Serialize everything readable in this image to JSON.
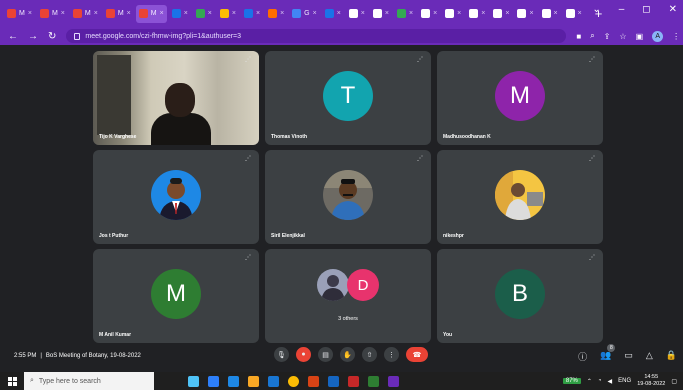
{
  "browser": {
    "tabs": [
      {
        "label": "M",
        "color": "#ea4335"
      },
      {
        "label": "M",
        "color": "#ea4335"
      },
      {
        "label": "M",
        "color": "#ea4335"
      },
      {
        "label": "M",
        "color": "#ea4335"
      },
      {
        "label": "M",
        "color": "#ea4335",
        "active": true
      },
      {
        "label": "",
        "color": "#1a73e8"
      },
      {
        "label": "",
        "color": "#34a853"
      },
      {
        "label": "",
        "color": "#fbbc04"
      },
      {
        "label": "",
        "color": "#1a73e8"
      },
      {
        "label": "",
        "color": "#ff6d00"
      },
      {
        "label": "G",
        "color": "#4285f4"
      },
      {
        "label": "",
        "color": "#1a73e8"
      },
      {
        "label": "",
        "color": "#ffffff"
      },
      {
        "label": "",
        "color": "#ffffff"
      },
      {
        "label": "",
        "color": "#34a853"
      },
      {
        "label": "",
        "color": "#ffffff"
      },
      {
        "label": "",
        "color": "#ffffff"
      },
      {
        "label": "",
        "color": "#ffffff"
      },
      {
        "label": "",
        "color": "#ffffff"
      },
      {
        "label": "",
        "color": "#ffffff"
      },
      {
        "label": "",
        "color": "#ffffff"
      },
      {
        "label": "",
        "color": "#ffffff"
      }
    ],
    "url": "meet.google.com/czi-fhmw-img?pli=1&authuser=3",
    "profile_initial": "A"
  },
  "meet": {
    "tiles": [
      {
        "name": "Tijo K Varghese",
        "kind": "video"
      },
      {
        "name": "Thomas Vinoth",
        "kind": "initial",
        "initial": "T",
        "color": "#12a4af"
      },
      {
        "name": "Madhusoodhanan K",
        "kind": "initial",
        "initial": "M",
        "color": "#8e24aa"
      },
      {
        "name": "Jos t Puthur",
        "kind": "photo"
      },
      {
        "name": "Siril Elenjikkal",
        "kind": "photo"
      },
      {
        "name": "nikeshpr",
        "kind": "photo"
      },
      {
        "name": "M Anil Kumar",
        "kind": "initial",
        "initial": "M",
        "color": "#2e7d32"
      },
      {
        "name": "3 others",
        "kind": "group",
        "initial": "D",
        "color": "#e8336d"
      },
      {
        "name": "You",
        "kind": "initial",
        "initial": "B",
        "color": "#1b5e4a"
      }
    ],
    "time": "2:55 PM",
    "separator": "|",
    "meeting_title": "BoS Meeting of Botany, 19-08-2022",
    "participant_count": "8"
  },
  "taskbar": {
    "search_placeholder": "Type here to search",
    "battery": "87%",
    "lang": "ENG",
    "clock_time": "14:55",
    "clock_date": "19-08-2022"
  }
}
